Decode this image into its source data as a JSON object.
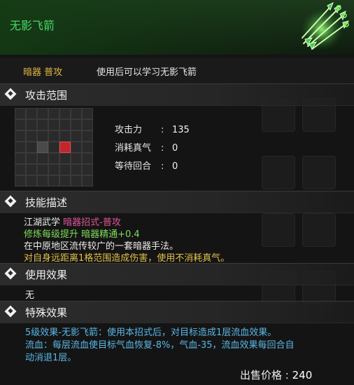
{
  "colors": {
    "title_green": "#48d86a",
    "tag_gold": "#e0b443",
    "target_red": "#c0272d",
    "pink": "#e0559a",
    "green": "#7fdc5b",
    "yellow": "#e3c04a",
    "blue": "#5ab8e6"
  },
  "header": {
    "title": "无影飞箭",
    "icon": "green-flying-darts-icon"
  },
  "subtitle": {
    "tag": "暗器 普攻",
    "description": "使用后可以学习无影飞箭"
  },
  "sections": {
    "range": {
      "label": "攻击范围",
      "icon": "diamond-bullet-icon"
    },
    "skill_desc": {
      "label": "技能描述",
      "icon": "diamond-bullet-icon"
    },
    "use_effect": {
      "label": "使用效果",
      "icon": "diamond-bullet-icon"
    },
    "special_effect": {
      "label": "特殊效果",
      "icon": "diamond-bullet-icon"
    }
  },
  "range_grid": {
    "rows": 7,
    "cols": 7,
    "self_cell": [
      3,
      2
    ],
    "target_cells": [
      [
        3,
        4
      ]
    ]
  },
  "stats": [
    {
      "key": "攻击力",
      "colon": ":",
      "value": "135"
    },
    {
      "key": "消耗真气",
      "colon": ":",
      "value": "0"
    },
    {
      "key": "等待回合",
      "colon": ":",
      "value": "0"
    }
  ],
  "skill_desc": {
    "line1_a": "江湖武学",
    "line1_b": "暗器招式-普攻",
    "line2": "修炼每级提升 暗器精通+0.4",
    "line3": "在中原地区流传较广的一套暗器手法。",
    "line4": "对自身远距离1格范围造成伤害，使用不消耗真气。"
  },
  "use_effect": {
    "text": "无"
  },
  "special_effect": {
    "line1": "5级效果-无影飞箭：使用本招式后，对目标造成1层流血效果。",
    "line2": "流血：每层流血使目标气血恢复-8%，气血-35，流血效果每回合自",
    "line3": "动消退1层。"
  },
  "footer": {
    "price_label": "出售价格",
    "price_colon": ":",
    "price_value": "240"
  }
}
